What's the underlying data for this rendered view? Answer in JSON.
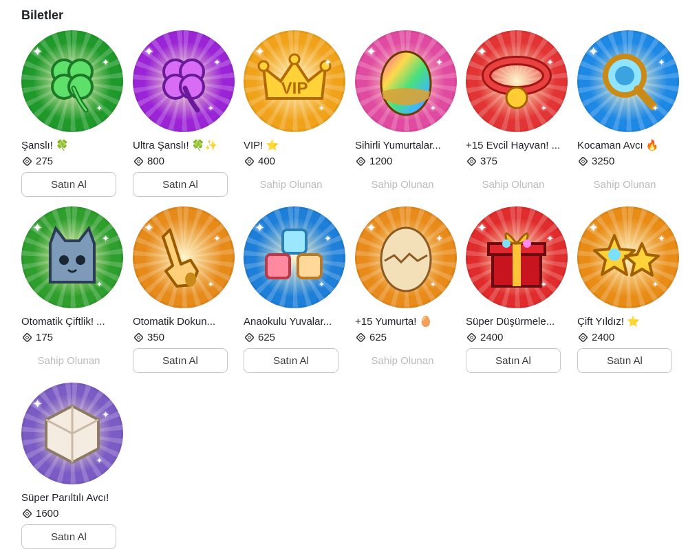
{
  "section": {
    "title": "Biletler"
  },
  "owned_label": "Sahip Olunan",
  "buy_label": "Satın Al",
  "passes": [
    {
      "name": "Şanslı! 🍀",
      "price": "275",
      "status": "buy",
      "icon": "four-leaf-clover-icon",
      "bg": "#1f9a2a"
    },
    {
      "name": "Ultra Şanslı! 🍀✨",
      "price": "800",
      "status": "buy",
      "icon": "purple-clover-icon",
      "bg": "#9b25d6"
    },
    {
      "name": "VIP! ⭐",
      "price": "400",
      "status": "owned",
      "icon": "vip-crown-icon",
      "bg": "#f0a21a"
    },
    {
      "name": "Sihirli Yumurtalar...",
      "price": "1200",
      "status": "owned",
      "icon": "rainbow-egg-icon",
      "bg": "#e04aa0"
    },
    {
      "name": "+15 Evcil Hayvan! ...",
      "price": "375",
      "status": "owned",
      "icon": "pet-collar-icon",
      "bg": "#e23434"
    },
    {
      "name": "Kocaman Avcı 🔥",
      "price": "3250",
      "status": "owned",
      "icon": "magnifier-icon",
      "bg": "#1e88e5"
    },
    {
      "name": "Otomatik Çiftlik! ...",
      "price": "175",
      "status": "owned",
      "icon": "cat-cube-icon",
      "bg": "#2e9e2c"
    },
    {
      "name": "Otomatik Dokun...",
      "price": "350",
      "status": "buy",
      "icon": "tap-hand-icon",
      "bg": "#e68a1a"
    },
    {
      "name": "Anaokulu Yuvalar...",
      "price": "625",
      "status": "buy",
      "icon": "cubes-icon",
      "bg": "#1e7fd8"
    },
    {
      "name": "+15 Yumurta! 🥚",
      "price": "625",
      "status": "owned",
      "icon": "cracked-egg-icon",
      "bg": "#e88b1a"
    },
    {
      "name": "Süper Düşürmele...",
      "price": "2400",
      "status": "buy",
      "icon": "gift-box-icon",
      "bg": "#e02c2c"
    },
    {
      "name": "Çift Yıldız! ⭐",
      "price": "2400",
      "status": "buy",
      "icon": "double-star-icon",
      "bg": "#e88c16"
    },
    {
      "name": "Süper Parıltılı Avcı!",
      "price": "1600",
      "status": "buy",
      "icon": "shiny-cube-icon",
      "bg": "#7b5bc4"
    }
  ]
}
